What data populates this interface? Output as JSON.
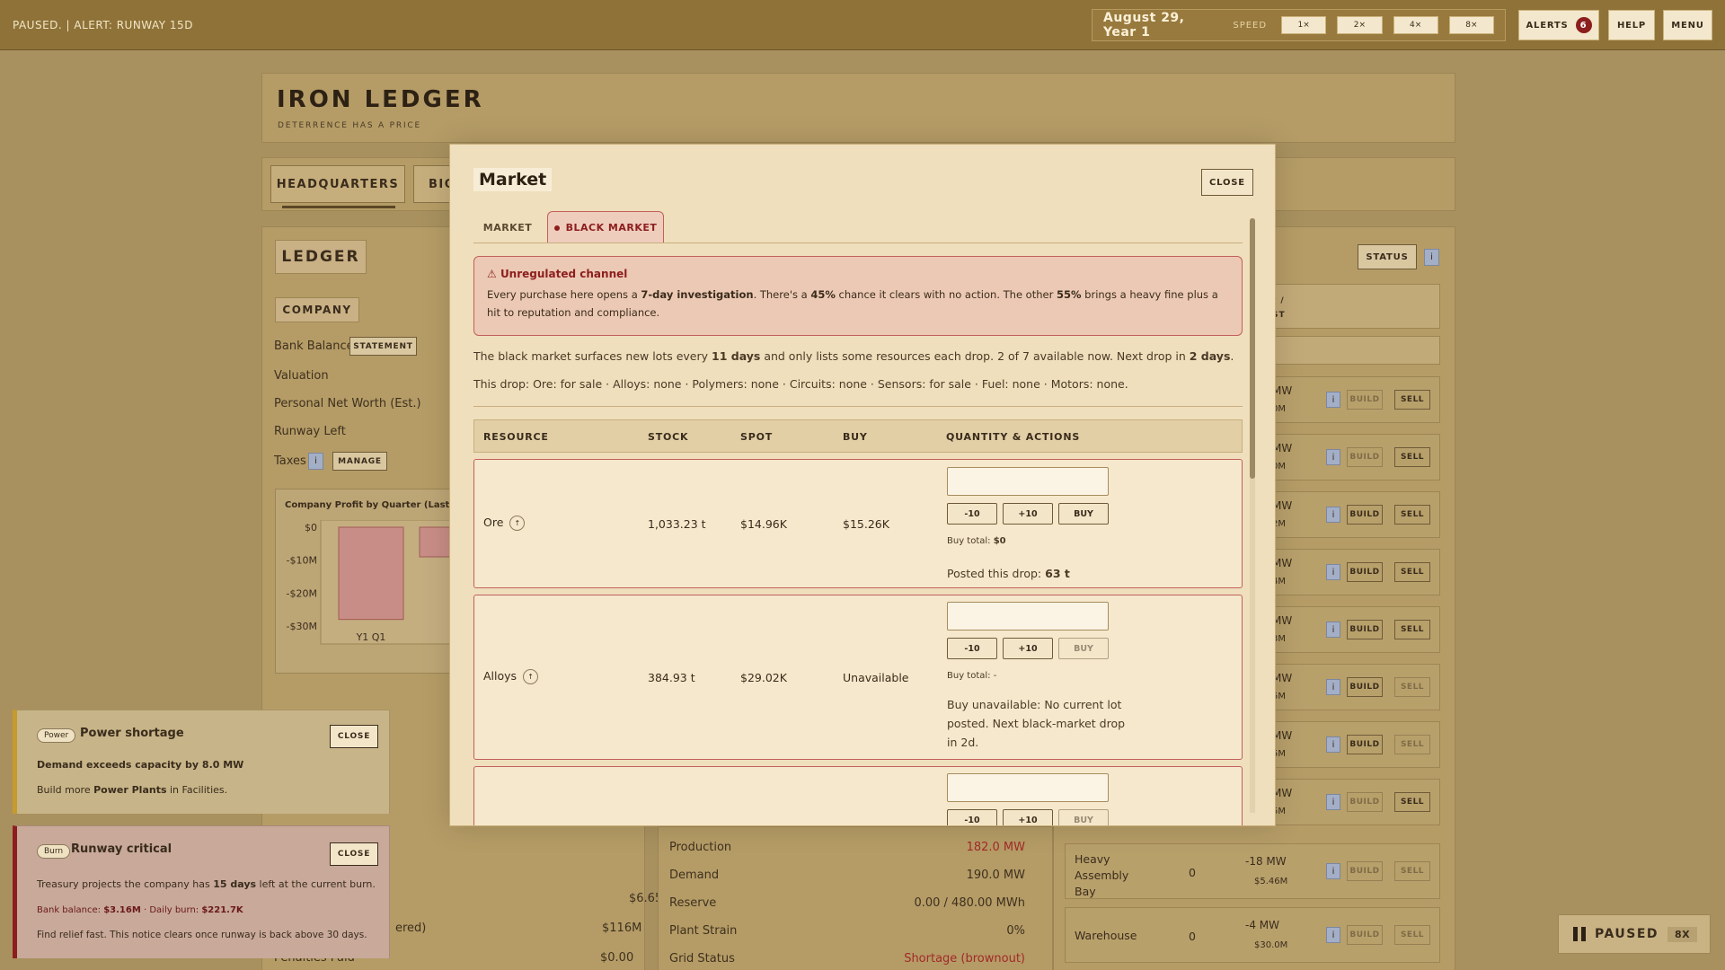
{
  "topbar": {
    "status": "PAUSED. | ALERT: RUNWAY 15D",
    "date": "August 29, Year 1",
    "speed_label": "SPEED",
    "speeds": [
      "1×",
      "2×",
      "4×",
      "8×"
    ],
    "alerts_label": "ALERTS",
    "alerts_count": "6",
    "help_label": "HELP",
    "menu_label": "MENU"
  },
  "app": {
    "title": "IRON LEDGER",
    "tagline": "DETERRENCE HAS A PRICE",
    "tabs": [
      "HEADQUARTERS",
      "BIO"
    ],
    "ledger_label": "LEDGER",
    "company_label": "COMPANY",
    "company_rows": [
      "Bank Balance",
      "Valuation",
      "Personal Net Worth (Est.)",
      "Runway Left",
      "Taxes"
    ],
    "statement_label": "STATEMENT",
    "manage_label": "MANAGE",
    "chart_title": "Company Profit by Quarter (Last 6 Q",
    "status_label": "STATUS",
    "st_partial": "t /\nST",
    "power_rows": [
      {
        "label": "Production",
        "value": "182.0 MW"
      },
      {
        "label": "Demand",
        "value": "190.0 MW"
      },
      {
        "label": "Reserve",
        "value": "0.00 / 480.00 MWh"
      },
      {
        "label": "Plant Strain",
        "value": "0%"
      },
      {
        "label": "Grid Status",
        "value": "Shortage (brownout)"
      }
    ],
    "ledger_values": [
      "$6.65M",
      "$116M",
      "$0.00"
    ],
    "ledger_partial_labels": [
      "ered)",
      "Penalties Paid"
    ],
    "facilities": [
      {
        "mw": "MW",
        "cost": "0M",
        "build": "BUILD",
        "sell": "SELL"
      },
      {
        "mw": "MW",
        "cost": "0M",
        "build": "BUILD",
        "sell": "SELL"
      },
      {
        "mw": "MW",
        "cost": "2M",
        "build": "BUILD",
        "sell": "SELL"
      },
      {
        "mw": "MW",
        "cost": "4M",
        "build": "BUILD",
        "sell": "SELL"
      },
      {
        "mw": "MW",
        "cost": "3M",
        "build": "BUILD",
        "sell": "SELL"
      },
      {
        "mw": "MW",
        "cost": "5M",
        "build": "BUILD",
        "sell": "SELL"
      },
      {
        "mw": "MW",
        "cost": "5M",
        "build": "BUILD",
        "sell": "SELL"
      },
      {
        "mw": "MW",
        "cost": "5M",
        "build": "BUILD",
        "sell": "SELL"
      },
      {
        "name": "Heavy Assembly Bay",
        "count": "0",
        "mw": "-18 MW",
        "cost": "$5.46M",
        "build": "BUILD",
        "sell": "SELL"
      },
      {
        "name": "Warehouse",
        "count": "0",
        "mw": "-4 MW",
        "cost": "$30.0M",
        "build": "BUILD",
        "sell": "SELL"
      }
    ]
  },
  "chart_data": {
    "type": "bar",
    "title": "Company Profit by Quarter (Last 6 Q",
    "categories": [
      "Y1 Q1"
    ],
    "values": [
      -28
    ],
    "yticks": [
      "$0",
      "-$10M",
      "-$20M",
      "-$30M"
    ],
    "ylim": [
      -30,
      0
    ],
    "units": "$M"
  },
  "modal": {
    "title": "Market",
    "close_label": "CLOSE",
    "tabs": [
      "MARKET",
      "BLACK MARKET"
    ],
    "warning_title": "Unregulated channel",
    "warning_text_parts": [
      "Every purchase here opens a ",
      "7-day investigation",
      ". There's a ",
      "45%",
      " chance it clears with no action. The other ",
      "55%",
      " brings a heavy fine plus a hit to reputation and compliance."
    ],
    "info1_parts": [
      "The black market surfaces new lots every ",
      "11 days",
      " and only lists some resources each drop. 2 of 7 available now. Next drop in ",
      "2 days",
      "."
    ],
    "info2": "This drop: Ore: for sale · Alloys: none · Polymers: none · Circuits: none · Sensors: for sale · Fuel: none · Motors: none.",
    "columns": [
      "RESOURCE",
      "STOCK",
      "SPOT",
      "BUY",
      "QUANTITY & ACTIONS"
    ],
    "rows": [
      {
        "resource": "Ore",
        "stock": "1,033.23 t",
        "spot": "$14.96K",
        "buy": "$15.26K",
        "buy_total_label": "Buy total:",
        "buy_total": "$0",
        "posted_label": "Posted this drop:",
        "posted": "63 t",
        "minus": "-10",
        "plus": "+10",
        "buy_btn": "BUY"
      },
      {
        "resource": "Alloys",
        "stock": "384.93 t",
        "spot": "$29.02K",
        "buy": "Unavailable",
        "buy_total_label": "Buy total:",
        "buy_total": "-",
        "note": "Buy unavailable: No current lot posted. Next black-market drop in 2d.",
        "minus": "-10",
        "plus": "+10",
        "buy_btn": "BUY"
      },
      {
        "minus": "-10",
        "plus": "+10",
        "buy_btn": "BUY"
      }
    ]
  },
  "toasts": [
    {
      "tag": "Power",
      "title": "Power shortage",
      "close": "CLOSE",
      "line1": "Demand exceeds capacity by 8.0 MW",
      "line2_parts": [
        "Build more ",
        "Power Plants",
        " in Facilities."
      ]
    },
    {
      "tag": "Burn",
      "title": "Runway critical",
      "close": "CLOSE",
      "line1_parts": [
        "Treasury projects the company has ",
        "15 days",
        " left at the current burn."
      ],
      "line2_parts": [
        "Bank balance: ",
        "$3.16M",
        " · Daily burn: ",
        "$221.7K"
      ],
      "line3": "Find relief fast. This notice clears once runway is back above 30 days."
    }
  ],
  "paused": {
    "label": "PAUSED",
    "speed": "8X"
  }
}
